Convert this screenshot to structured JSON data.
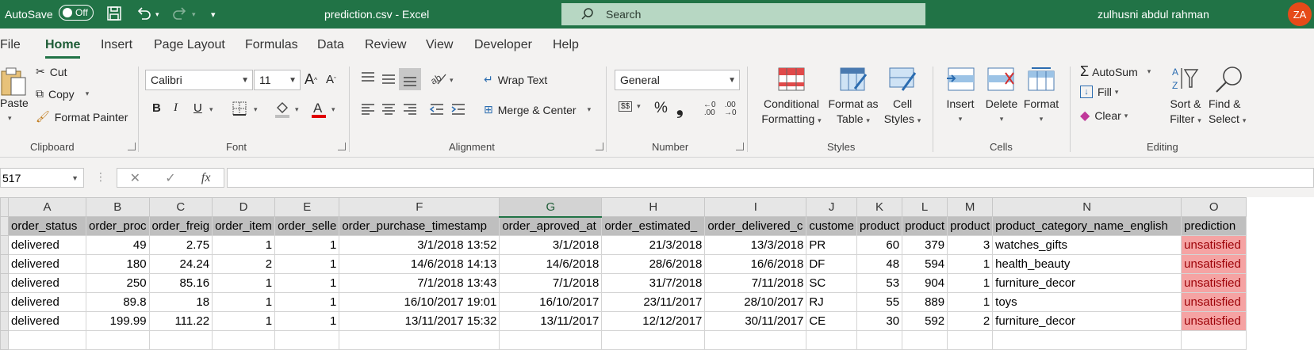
{
  "titlebar": {
    "autosave_label": "AutoSave",
    "autosave_state": "Off",
    "document_title": "prediction.csv  -  Excel",
    "search_placeholder": "Search",
    "user_name": "zulhusni abdul rahman",
    "user_initials": "ZA"
  },
  "tabs": [
    "File",
    "Home",
    "Insert",
    "Page Layout",
    "Formulas",
    "Data",
    "Review",
    "View",
    "Developer",
    "Help"
  ],
  "active_tab": "Home",
  "ribbon": {
    "clipboard": {
      "paste": "Paste",
      "cut": "Cut",
      "copy": "Copy",
      "format_painter": "Format Painter",
      "label": "Clipboard"
    },
    "font": {
      "family": "Calibri",
      "size": "11",
      "bold": "B",
      "italic": "I",
      "underline": "U",
      "label": "Font"
    },
    "alignment": {
      "wrap_text": "Wrap Text",
      "merge_center": "Merge & Center",
      "label": "Alignment"
    },
    "number": {
      "format": "General",
      "percent": "%",
      "comma": "❟",
      "label": "Number"
    },
    "styles": {
      "conditional_1": "Conditional",
      "conditional_2": "Formatting",
      "format_table_1": "Format as",
      "format_table_2": "Table",
      "cell_styles_1": "Cell",
      "cell_styles_2": "Styles",
      "label": "Styles"
    },
    "cells": {
      "insert": "Insert",
      "delete": "Delete",
      "format": "Format",
      "label": "Cells"
    },
    "editing": {
      "autosum": "AutoSum",
      "fill": "Fill",
      "clear": "Clear",
      "sort_1": "Sort &",
      "sort_2": "Filter",
      "find_1": "Find &",
      "find_2": "Select",
      "label": "Editing"
    }
  },
  "formula_bar": {
    "name_box": "517",
    "fx": "fx",
    "formula": ""
  },
  "sheet": {
    "column_letters": [
      "A",
      "B",
      "C",
      "D",
      "E",
      "F",
      "G",
      "H",
      "I",
      "J",
      "K",
      "L",
      "M",
      "N",
      "O"
    ],
    "selected_column": "G",
    "headers": [
      "order_status",
      "order_proc",
      "order_freig",
      "order_item",
      "order_selle",
      "order_purchase_timestamp",
      "order_aproved_at",
      "order_estimated_",
      "order_delivered_c",
      "custome",
      "product",
      "product",
      "product",
      "product_category_name_english",
      "prediction"
    ],
    "rows": [
      [
        "delivered",
        "49",
        "2.75",
        "1",
        "1",
        "3/1/2018 13:52",
        "3/1/2018",
        "21/3/2018",
        "13/3/2018",
        "PR",
        "60",
        "379",
        "3",
        "watches_gifts",
        "unsatisfied"
      ],
      [
        "delivered",
        "180",
        "24.24",
        "2",
        "1",
        "14/6/2018 14:13",
        "14/6/2018",
        "28/6/2018",
        "16/6/2018",
        "DF",
        "48",
        "594",
        "1",
        "health_beauty",
        "unsatisfied"
      ],
      [
        "delivered",
        "250",
        "85.16",
        "1",
        "1",
        "7/1/2018 13:43",
        "7/1/2018",
        "31/7/2018",
        "7/11/2018",
        "SC",
        "53",
        "904",
        "1",
        "furniture_decor",
        "unsatisfied"
      ],
      [
        "delivered",
        "89.8",
        "18",
        "1",
        "1",
        "16/10/2017 19:01",
        "16/10/2017",
        "23/11/2017",
        "28/10/2017",
        "RJ",
        "55",
        "889",
        "1",
        "toys",
        "unsatisfied"
      ],
      [
        "delivered",
        "199.99",
        "111.22",
        "1",
        "1",
        "13/11/2017 15:32",
        "13/11/2017",
        "12/12/2017",
        "30/11/2017",
        "CE",
        "30",
        "592",
        "2",
        "furniture_decor",
        "unsatisfied"
      ]
    ]
  },
  "colors": {
    "excel_green": "#217346",
    "prediction_fill": "#f5a3a3",
    "prediction_text": "#9c0006"
  }
}
